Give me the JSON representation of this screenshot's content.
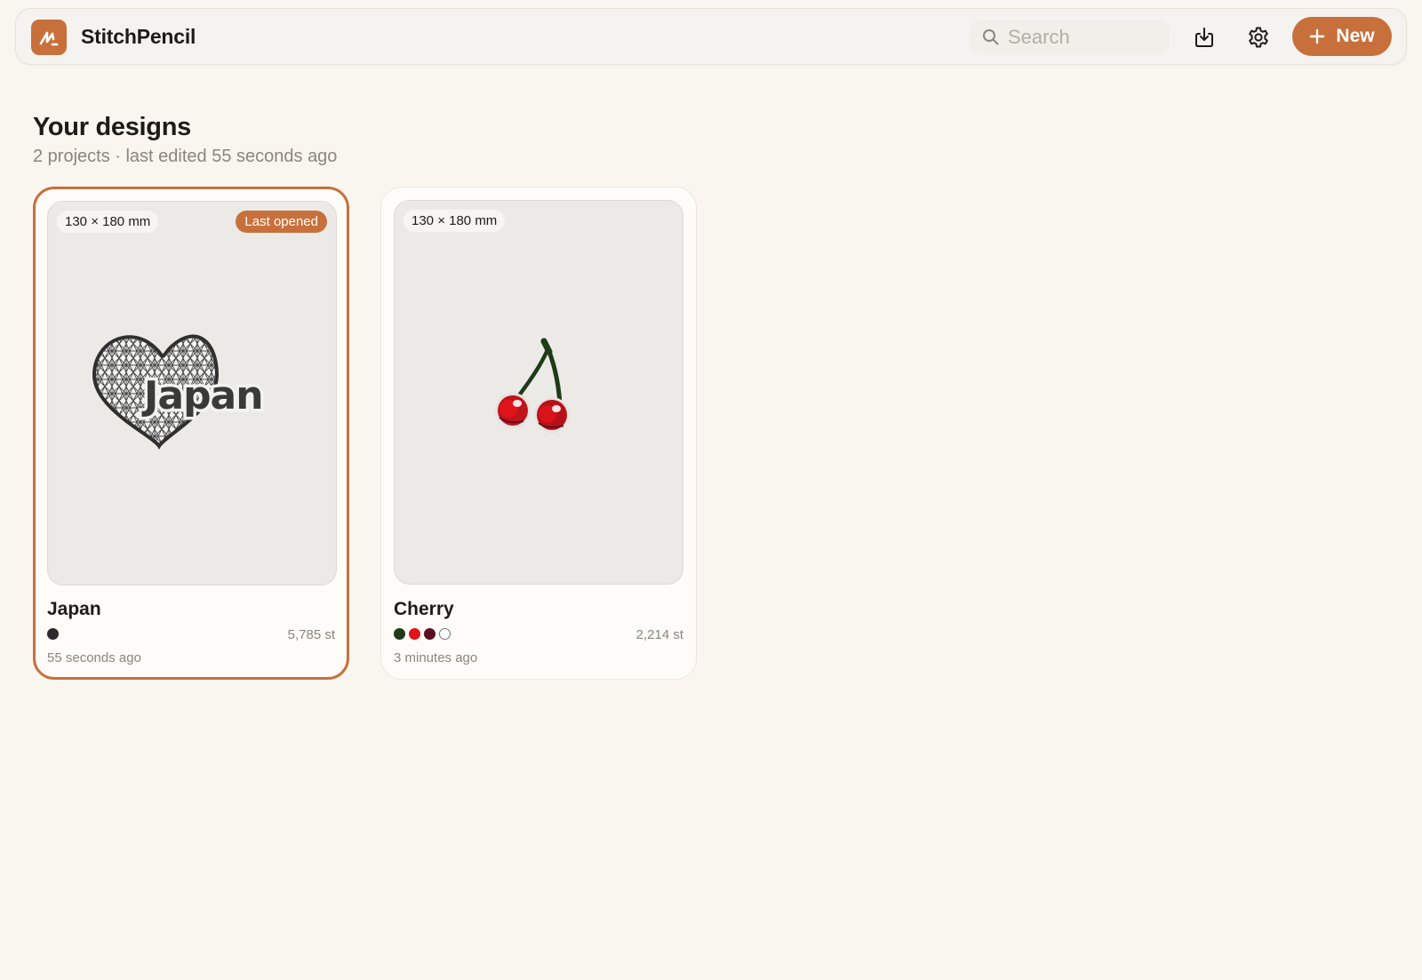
{
  "app": {
    "name": "StitchPencil",
    "logo_icon": "pencil-scribble-icon",
    "accent_color": "#c8703b"
  },
  "header": {
    "search_placeholder": "Search",
    "search_value": "",
    "import_icon": "download-icon",
    "settings_icon": "gear-icon",
    "new_label": "New"
  },
  "main": {
    "title": "Your designs",
    "subtitle": "2 projects · last edited 55 seconds ago",
    "projects": [
      {
        "name": "Japan",
        "size": "130 × 180 mm",
        "badge": "Last opened",
        "selected": true,
        "thread_colors": [
          "#2b2b2b"
        ],
        "stitches": "5,785 st",
        "edited": "55 seconds ago",
        "preview": "japan-heart-embroidery",
        "preview_text": "Japan"
      },
      {
        "name": "Cherry",
        "size": "130 × 180 mm",
        "badge": "",
        "selected": false,
        "thread_colors": [
          "#1f3a16",
          "#e0141a",
          "#5a1020",
          "#ffffff"
        ],
        "stitches": "2,214 st",
        "edited": "3 minutes ago",
        "preview": "cherry-embroidery"
      }
    ]
  }
}
